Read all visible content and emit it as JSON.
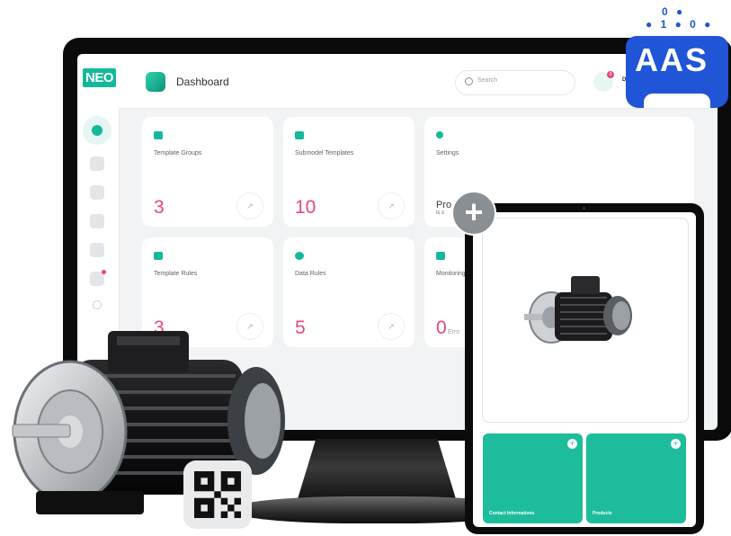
{
  "badge": {
    "text": "AAS",
    "bits_top": "0 ●",
    "bits_bottom": "● 1 ● 0 ●",
    "color": "#1f55d6"
  },
  "app": {
    "logo": "NEO",
    "header_title": "Dashboard",
    "search_placeholder": "Search",
    "notification_count": "0",
    "user_initial": "D"
  },
  "sidebar_icons": [
    "dashboard-icon",
    "folder-icon",
    "template-icon",
    "document-icon",
    "puzzle-icon",
    "monitor-icon",
    "settings-icon",
    "user-icon"
  ],
  "cards": [
    {
      "title": "Template Groups",
      "value": "3",
      "icon": "folder-icon"
    },
    {
      "title": "Submodel Templates",
      "value": "10",
      "icon": "stack-icon"
    },
    {
      "title": "Settings",
      "value": "",
      "icon": "gear-icon",
      "partial_title": "Pro",
      "partial_sub": "is s"
    },
    {
      "title": "Template Rules",
      "value": "3",
      "icon": "edit-icon"
    },
    {
      "title": "Data Rules",
      "value": "5",
      "icon": "puzzle-icon"
    },
    {
      "title": "Monitoring",
      "value": "0",
      "sub": "Erro",
      "icon": "monitor-icon"
    }
  ],
  "tablet": {
    "tiles": [
      {
        "label": "Contact Informations"
      },
      {
        "label": "Products"
      }
    ]
  },
  "colors": {
    "accent": "#14b89a",
    "value": "#e8467c"
  }
}
